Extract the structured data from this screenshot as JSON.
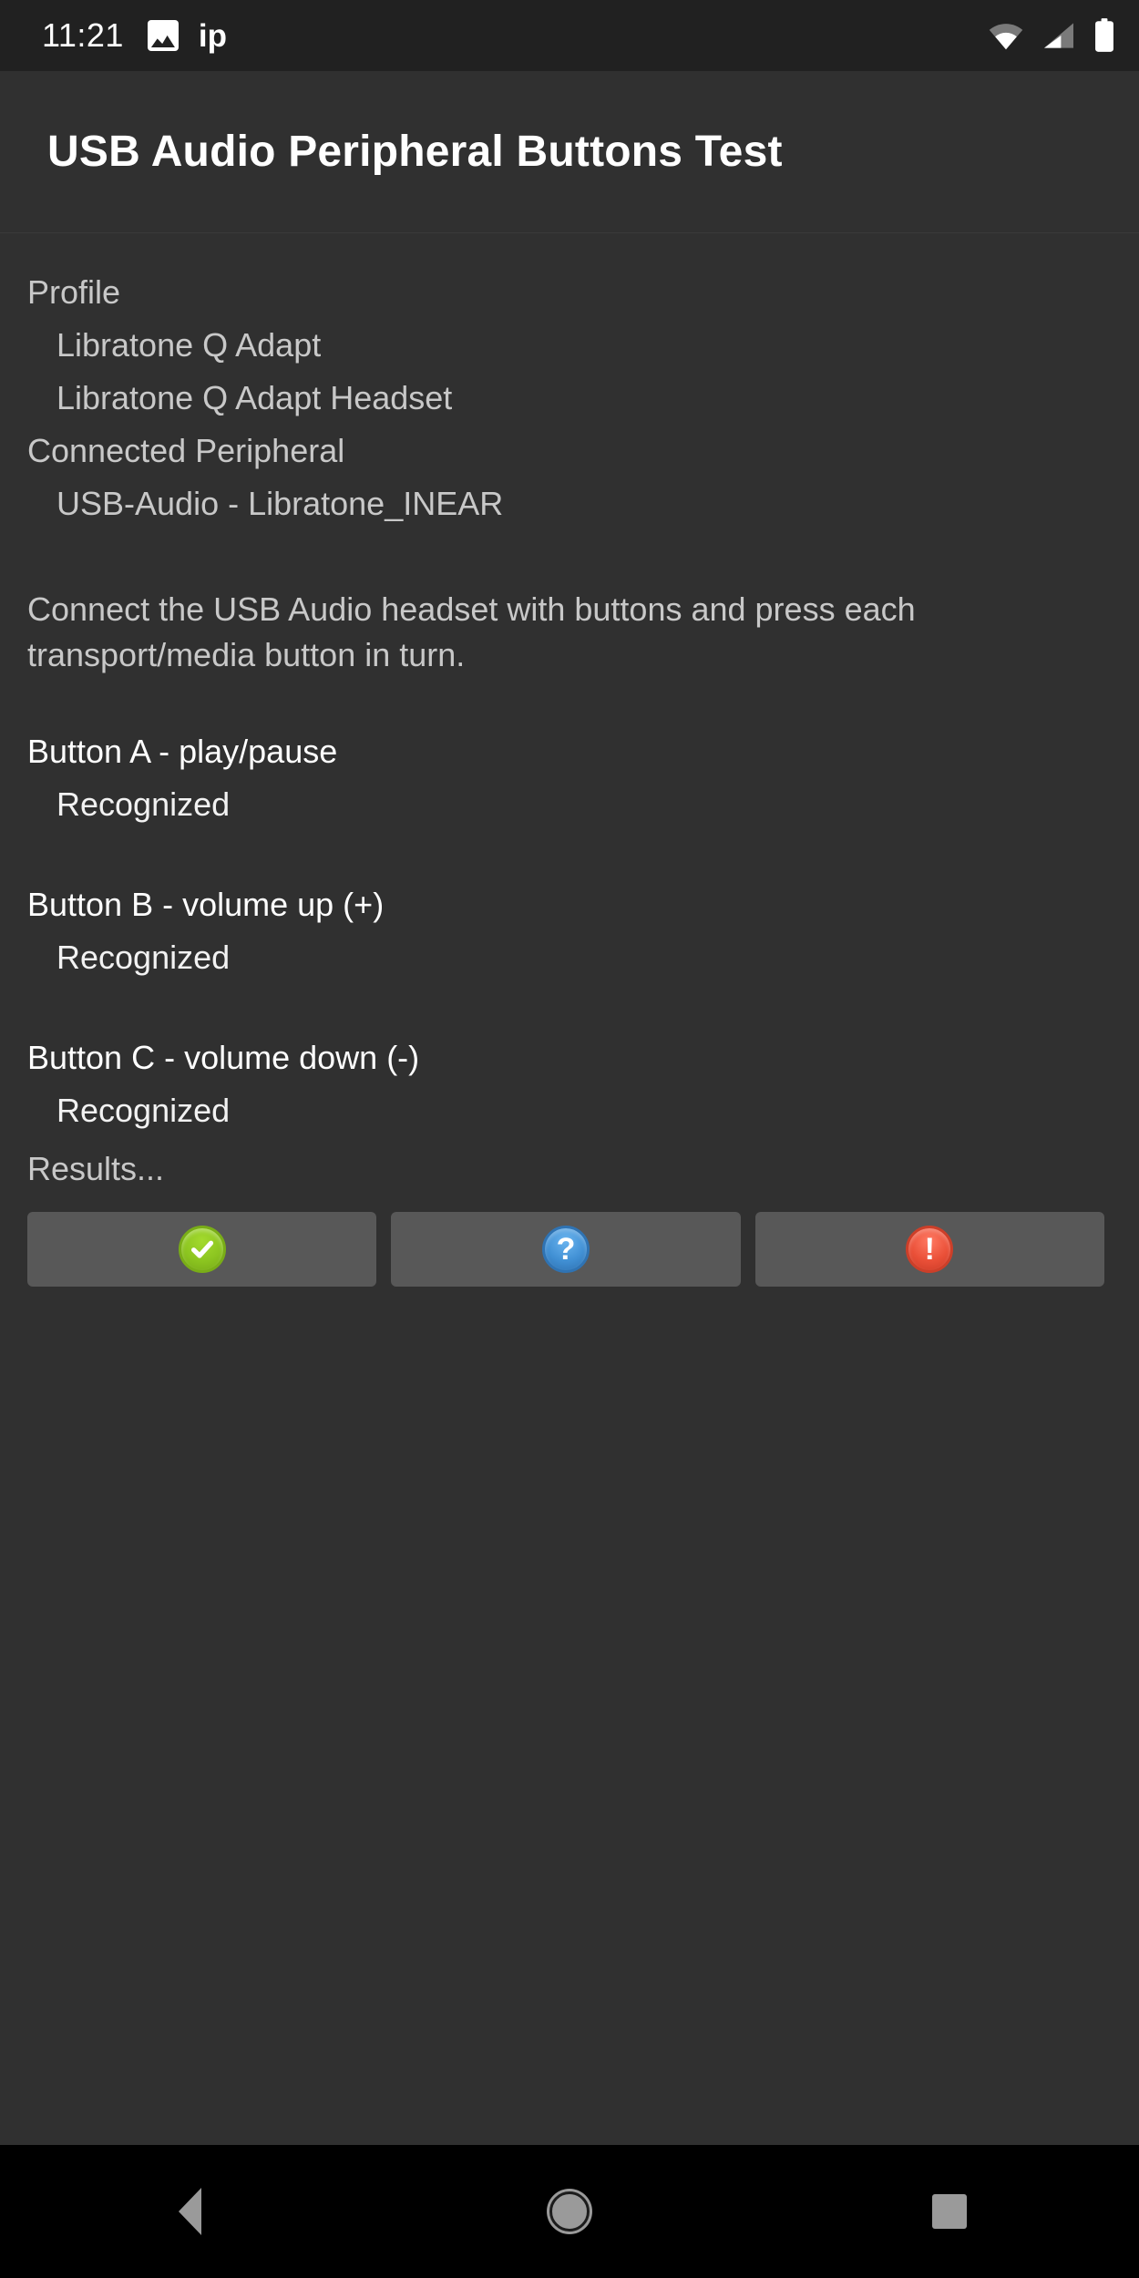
{
  "status_bar": {
    "clock": "11:21",
    "notification_icon": "photo-icon",
    "notification_text": "ip",
    "wifi_icon": "wifi-icon",
    "signal_icon": "cell-signal-icon",
    "battery_icon": "battery-full-icon"
  },
  "header": {
    "title": "USB Audio Peripheral Buttons Test"
  },
  "main": {
    "profile_label": "Profile",
    "profile_values": [
      "Libratone Q Adapt",
      "Libratone Q Adapt Headset"
    ],
    "connected_label": "Connected Peripheral",
    "connected_value": "USB-Audio - Libratone_INEAR",
    "instructions": "Connect the USB Audio headset with buttons and press each transport/media button in turn.",
    "buttons": [
      {
        "label": "Button A - play/pause",
        "status": "Recognized"
      },
      {
        "label": "Button B - volume up (+)",
        "status": "Recognized"
      },
      {
        "label": "Button C - volume down (-)",
        "status": "Recognized"
      }
    ],
    "results_label": "Results..."
  },
  "result_buttons": [
    {
      "name": "pass-button",
      "icon": "check-circle-icon",
      "glyph": "✔",
      "color": "#8cc520"
    },
    {
      "name": "info-button",
      "icon": "question-circle-icon",
      "glyph": "?",
      "color": "#4190d4"
    },
    {
      "name": "fail-button",
      "icon": "exclamation-circle-icon",
      "glyph": "!",
      "color": "#ea5038"
    }
  ],
  "nav_bar": {
    "back": "back-icon",
    "home": "home-icon",
    "recents": "recents-icon"
  },
  "colors": {
    "background": "#303030",
    "status_bar": "#212121",
    "button_face": "#585858",
    "nav_bar": "#000000",
    "text_primary": "#ffffff",
    "text_secondary": "#c8c8c8"
  }
}
